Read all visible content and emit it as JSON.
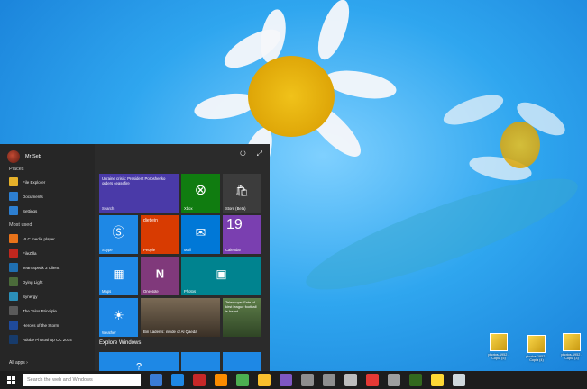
{
  "user": {
    "name": "Mr Seb"
  },
  "places": {
    "label": "Places",
    "items": [
      {
        "label": "File Explorer",
        "color": "#e6b12a"
      },
      {
        "label": "Documents",
        "color": "#2d7fd1"
      },
      {
        "label": "Settings",
        "color": "#2d7fd1"
      }
    ]
  },
  "most_used": {
    "label": "Most used",
    "items": [
      {
        "label": "VLC media player",
        "color": "#e8731a"
      },
      {
        "label": "FileZilla",
        "color": "#c0271e"
      },
      {
        "label": "TeamSpeak 3 Client",
        "color": "#1f6fb0"
      },
      {
        "label": "Dying Light",
        "color": "#4b6b3a"
      },
      {
        "label": "Synergy",
        "color": "#2b8fb8"
      },
      {
        "label": "The Talos Principle",
        "color": "#5a5a5a"
      },
      {
        "label": "Heroes of the Storm",
        "color": "#1f4a9a"
      },
      {
        "label": "Adobe Photoshop CC 2014",
        "color": "#173b6b"
      }
    ]
  },
  "all_apps": "All apps",
  "tiles": {
    "search_news": "Ukraine crisis: President Poroshenko orders ceasefire",
    "search": "Search",
    "xbox": "Xbox",
    "store": "Store (Beta)",
    "skype": "Skype",
    "people_name": "dietlein",
    "people": "People",
    "mail": "Mail",
    "calendar_day": "19",
    "calendar": "Calendar",
    "maps": "Maps",
    "onenote": "OneNote",
    "photos": "Photos",
    "weather": "Weather",
    "news_headline": "Bin Laden's: inside of Al Qaeda",
    "sports_headline": "Telescope: Fate of kirst league football is heard"
  },
  "explore": "Explore Windows",
  "desktop_icons": [
    {
      "caption": "photos-1952 - Copia (5)"
    },
    {
      "caption": "photos-1952 - Copia (4)"
    },
    {
      "caption": "photos-1952 - Copia (3)"
    }
  ],
  "taskbar": {
    "search_placeholder": "Search the web and Windows",
    "icon_colors": [
      "#3a7bd5",
      "#1e88e5",
      "#c62828",
      "#fb8c00",
      "#4caf50",
      "#fbc02d",
      "#7e57c2",
      "#8e8e8e",
      "#8e8e8e",
      "#bdbdbd",
      "#e53935",
      "#9e9e9e",
      "#33691e",
      "#fdd835",
      "#cfd8dc"
    ]
  }
}
